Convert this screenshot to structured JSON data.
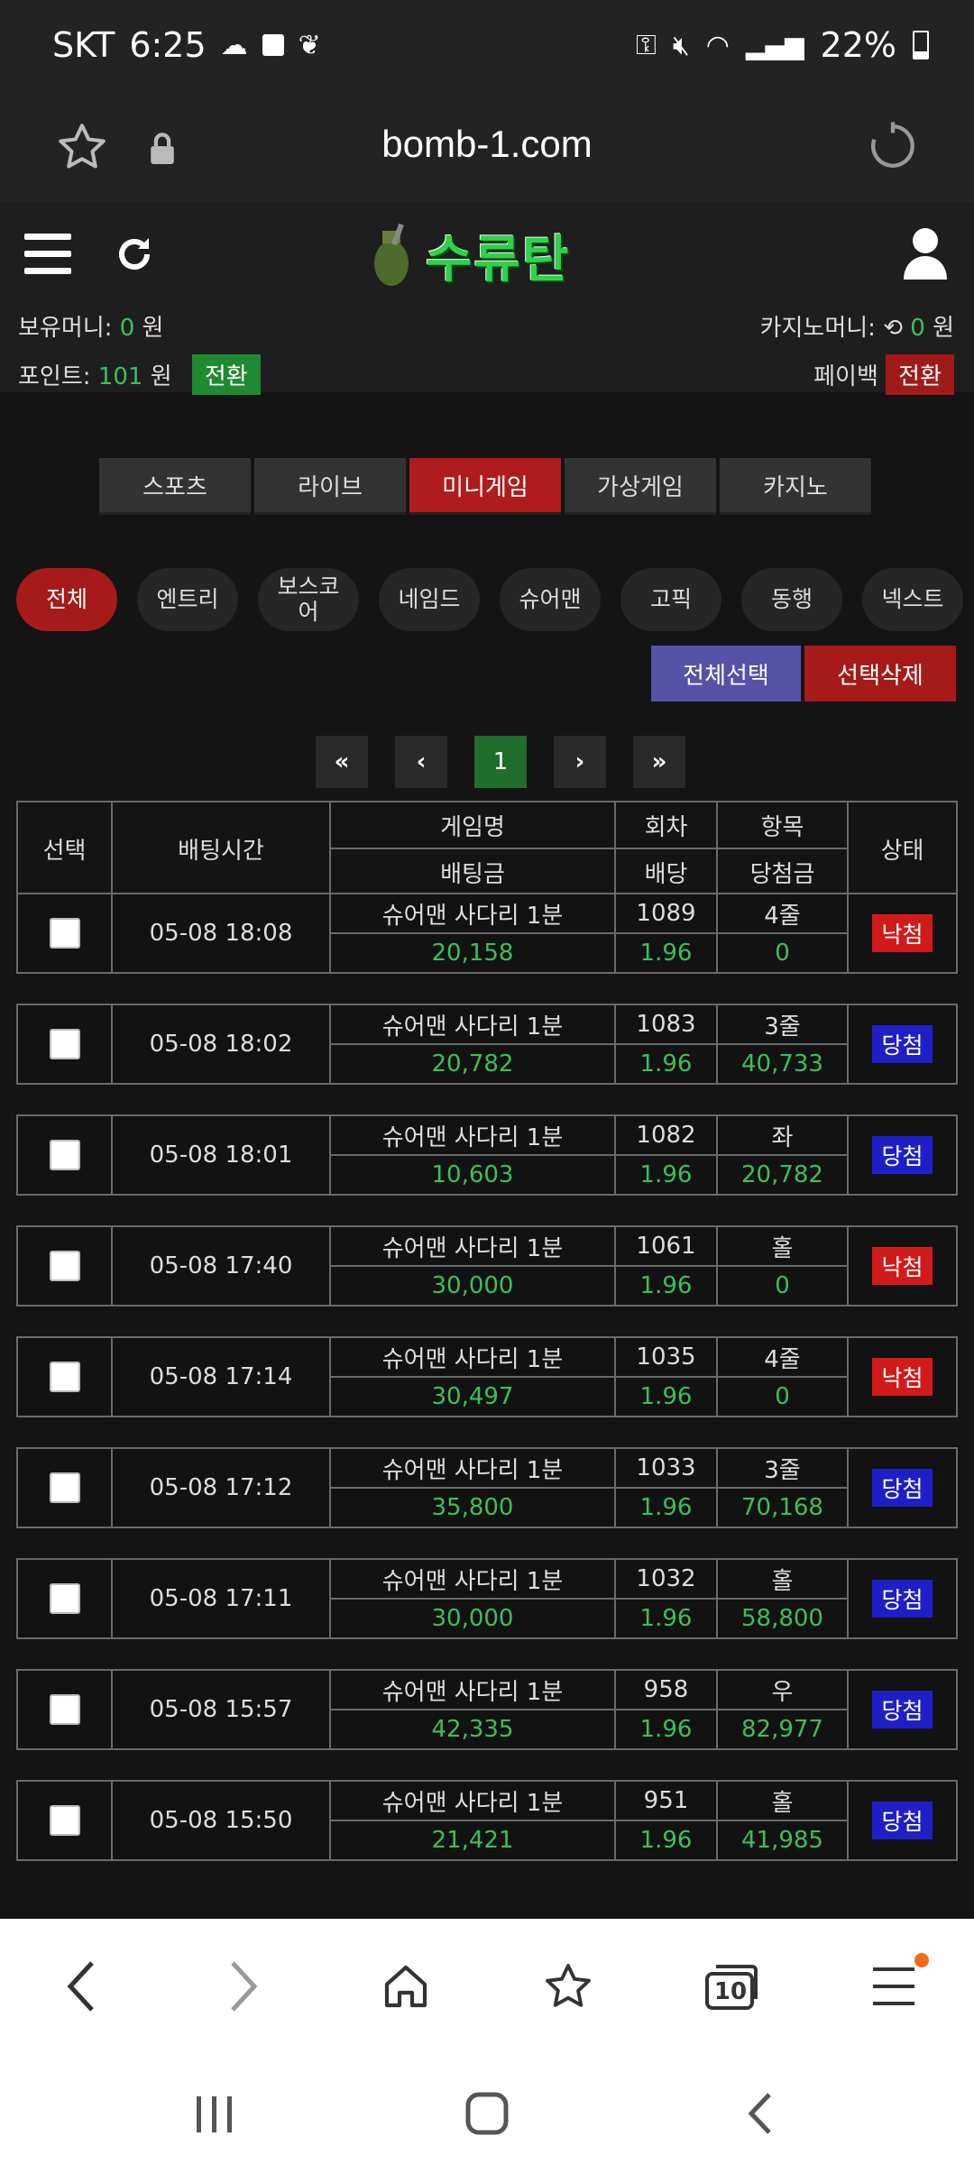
{
  "status_bar": {
    "carrier": "SKT",
    "time": "6:25",
    "battery": "22%"
  },
  "url_bar": {
    "url": "bomb-1.com"
  },
  "header": {
    "logo_text": "수류탄"
  },
  "balances": {
    "hold_label": "보유머니:",
    "hold_value": "0",
    "hold_unit": "원",
    "casino_label": "카지노머니:",
    "casino_value": "0",
    "casino_unit": "원",
    "point_label": "포인트:",
    "point_value": "101",
    "point_unit": "원",
    "convert_label": "전환",
    "payback_label": "페이백",
    "payback_convert": "전환"
  },
  "tabs": [
    "스포츠",
    "라이브",
    "미니게임",
    "가상게임",
    "카지노"
  ],
  "active_tab": 2,
  "chips": [
    "전체",
    "엔트리",
    "보스코\n어",
    "네임드",
    "슈어맨",
    "고픽",
    "동행",
    "넥스트"
  ],
  "actions": {
    "select_all": "전체선택",
    "delete_selected": "선택삭제"
  },
  "pager": {
    "first": "«",
    "prev": "‹",
    "current": "1",
    "next": "›",
    "last": "»"
  },
  "table_header": {
    "select": "선택",
    "time": "배팅시간",
    "game": "게임명",
    "amount": "배팅금",
    "round": "회차",
    "odds": "배당",
    "item": "항목",
    "payout": "당첨금",
    "status": "상태"
  },
  "rows": [
    {
      "time": "05-08 18:08",
      "game": "슈어맨 사다리 1분",
      "amount": "20,158",
      "round": "1089",
      "odds": "1.96",
      "item": "4줄",
      "payout": "0",
      "status": "낙첨",
      "win": false
    },
    {
      "time": "05-08 18:02",
      "game": "슈어맨 사다리 1분",
      "amount": "20,782",
      "round": "1083",
      "odds": "1.96",
      "item": "3줄",
      "payout": "40,733",
      "status": "당첨",
      "win": true
    },
    {
      "time": "05-08 18:01",
      "game": "슈어맨 사다리 1분",
      "amount": "10,603",
      "round": "1082",
      "odds": "1.96",
      "item": "좌",
      "payout": "20,782",
      "status": "당첨",
      "win": true
    },
    {
      "time": "05-08 17:40",
      "game": "슈어맨 사다리 1분",
      "amount": "30,000",
      "round": "1061",
      "odds": "1.96",
      "item": "홀",
      "payout": "0",
      "status": "낙첨",
      "win": false
    },
    {
      "time": "05-08 17:14",
      "game": "슈어맨 사다리 1분",
      "amount": "30,497",
      "round": "1035",
      "odds": "1.96",
      "item": "4줄",
      "payout": "0",
      "status": "낙첨",
      "win": false
    },
    {
      "time": "05-08 17:12",
      "game": "슈어맨 사다리 1분",
      "amount": "35,800",
      "round": "1033",
      "odds": "1.96",
      "item": "3줄",
      "payout": "70,168",
      "status": "당첨",
      "win": true
    },
    {
      "time": "05-08 17:11",
      "game": "슈어맨 사다리 1분",
      "amount": "30,000",
      "round": "1032",
      "odds": "1.96",
      "item": "홀",
      "payout": "58,800",
      "status": "당첨",
      "win": true
    },
    {
      "time": "05-08 15:57",
      "game": "슈어맨 사다리 1분",
      "amount": "42,335",
      "round": "958",
      "odds": "1.96",
      "item": "우",
      "payout": "82,977",
      "status": "당첨",
      "win": true
    },
    {
      "time": "05-08 15:50",
      "game": "슈어맨 사다리 1분",
      "amount": "21,421",
      "round": "951",
      "odds": "1.96",
      "item": "홀",
      "payout": "41,985",
      "status": "당첨",
      "win": true
    }
  ],
  "browser_nav": {
    "tab_count": "10"
  },
  "colors": {
    "accent_red": "#b01c1c",
    "accent_green": "#3cbf5a",
    "win_blue": "#1f1fc8",
    "lose_red": "#d11a1a",
    "select_all_purple": "#5552a8"
  }
}
